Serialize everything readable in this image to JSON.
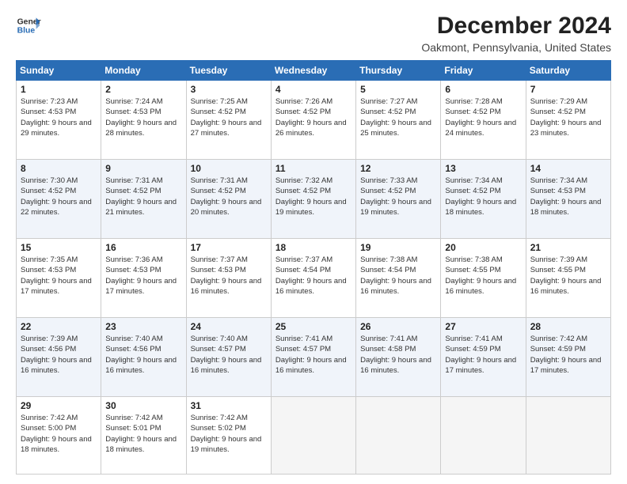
{
  "logo": {
    "line1": "General",
    "line2": "Blue"
  },
  "header": {
    "title": "December 2024",
    "subtitle": "Oakmont, Pennsylvania, United States"
  },
  "weekdays": [
    "Sunday",
    "Monday",
    "Tuesday",
    "Wednesday",
    "Thursday",
    "Friday",
    "Saturday"
  ],
  "weeks": [
    [
      {
        "day": "1",
        "sunrise": "7:23 AM",
        "sunset": "4:53 PM",
        "daylight": "9 hours and 29 minutes."
      },
      {
        "day": "2",
        "sunrise": "7:24 AM",
        "sunset": "4:53 PM",
        "daylight": "9 hours and 28 minutes."
      },
      {
        "day": "3",
        "sunrise": "7:25 AM",
        "sunset": "4:52 PM",
        "daylight": "9 hours and 27 minutes."
      },
      {
        "day": "4",
        "sunrise": "7:26 AM",
        "sunset": "4:52 PM",
        "daylight": "9 hours and 26 minutes."
      },
      {
        "day": "5",
        "sunrise": "7:27 AM",
        "sunset": "4:52 PM",
        "daylight": "9 hours and 25 minutes."
      },
      {
        "day": "6",
        "sunrise": "7:28 AM",
        "sunset": "4:52 PM",
        "daylight": "9 hours and 24 minutes."
      },
      {
        "day": "7",
        "sunrise": "7:29 AM",
        "sunset": "4:52 PM",
        "daylight": "9 hours and 23 minutes."
      }
    ],
    [
      {
        "day": "8",
        "sunrise": "7:30 AM",
        "sunset": "4:52 PM",
        "daylight": "9 hours and 22 minutes."
      },
      {
        "day": "9",
        "sunrise": "7:31 AM",
        "sunset": "4:52 PM",
        "daylight": "9 hours and 21 minutes."
      },
      {
        "day": "10",
        "sunrise": "7:31 AM",
        "sunset": "4:52 PM",
        "daylight": "9 hours and 20 minutes."
      },
      {
        "day": "11",
        "sunrise": "7:32 AM",
        "sunset": "4:52 PM",
        "daylight": "9 hours and 19 minutes."
      },
      {
        "day": "12",
        "sunrise": "7:33 AM",
        "sunset": "4:52 PM",
        "daylight": "9 hours and 19 minutes."
      },
      {
        "day": "13",
        "sunrise": "7:34 AM",
        "sunset": "4:52 PM",
        "daylight": "9 hours and 18 minutes."
      },
      {
        "day": "14",
        "sunrise": "7:34 AM",
        "sunset": "4:53 PM",
        "daylight": "9 hours and 18 minutes."
      }
    ],
    [
      {
        "day": "15",
        "sunrise": "7:35 AM",
        "sunset": "4:53 PM",
        "daylight": "9 hours and 17 minutes."
      },
      {
        "day": "16",
        "sunrise": "7:36 AM",
        "sunset": "4:53 PM",
        "daylight": "9 hours and 17 minutes."
      },
      {
        "day": "17",
        "sunrise": "7:37 AM",
        "sunset": "4:53 PM",
        "daylight": "9 hours and 16 minutes."
      },
      {
        "day": "18",
        "sunrise": "7:37 AM",
        "sunset": "4:54 PM",
        "daylight": "9 hours and 16 minutes."
      },
      {
        "day": "19",
        "sunrise": "7:38 AM",
        "sunset": "4:54 PM",
        "daylight": "9 hours and 16 minutes."
      },
      {
        "day": "20",
        "sunrise": "7:38 AM",
        "sunset": "4:55 PM",
        "daylight": "9 hours and 16 minutes."
      },
      {
        "day": "21",
        "sunrise": "7:39 AM",
        "sunset": "4:55 PM",
        "daylight": "9 hours and 16 minutes."
      }
    ],
    [
      {
        "day": "22",
        "sunrise": "7:39 AM",
        "sunset": "4:56 PM",
        "daylight": "9 hours and 16 minutes."
      },
      {
        "day": "23",
        "sunrise": "7:40 AM",
        "sunset": "4:56 PM",
        "daylight": "9 hours and 16 minutes."
      },
      {
        "day": "24",
        "sunrise": "7:40 AM",
        "sunset": "4:57 PM",
        "daylight": "9 hours and 16 minutes."
      },
      {
        "day": "25",
        "sunrise": "7:41 AM",
        "sunset": "4:57 PM",
        "daylight": "9 hours and 16 minutes."
      },
      {
        "day": "26",
        "sunrise": "7:41 AM",
        "sunset": "4:58 PM",
        "daylight": "9 hours and 16 minutes."
      },
      {
        "day": "27",
        "sunrise": "7:41 AM",
        "sunset": "4:59 PM",
        "daylight": "9 hours and 17 minutes."
      },
      {
        "day": "28",
        "sunrise": "7:42 AM",
        "sunset": "4:59 PM",
        "daylight": "9 hours and 17 minutes."
      }
    ],
    [
      {
        "day": "29",
        "sunrise": "7:42 AM",
        "sunset": "5:00 PM",
        "daylight": "9 hours and 18 minutes."
      },
      {
        "day": "30",
        "sunrise": "7:42 AM",
        "sunset": "5:01 PM",
        "daylight": "9 hours and 18 minutes."
      },
      {
        "day": "31",
        "sunrise": "7:42 AM",
        "sunset": "5:02 PM",
        "daylight": "9 hours and 19 minutes."
      },
      null,
      null,
      null,
      null
    ]
  ]
}
